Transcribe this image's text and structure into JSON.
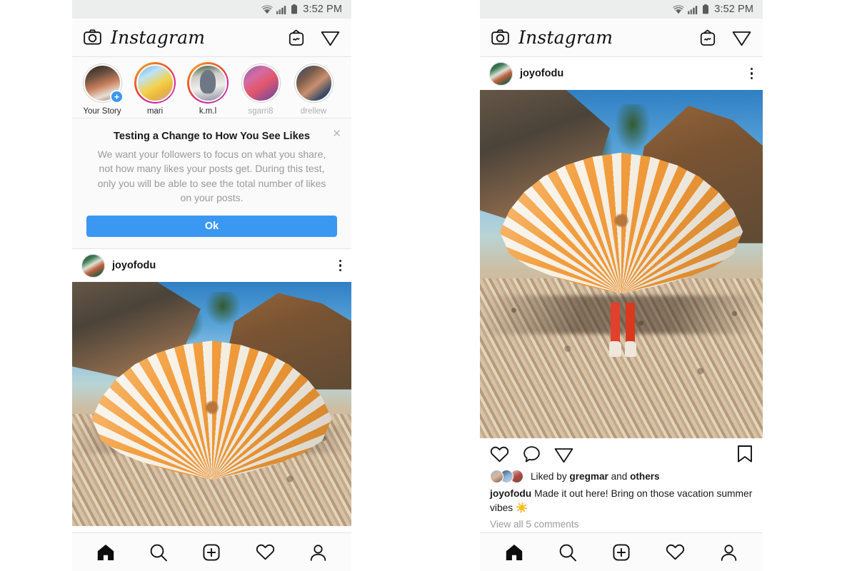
{
  "status_bar": {
    "time": "3:52 PM",
    "icons": [
      "wifi-icon",
      "cellular-signal-icon",
      "battery-icon"
    ]
  },
  "app_header": {
    "camera_icon": "camera-icon",
    "brand": "Instagram",
    "igtv_icon": "igtv-icon",
    "direct_message_icon": "direct-message-icon"
  },
  "stories": [
    {
      "name": "Your Story",
      "ring": "none",
      "muted": false,
      "has_add_badge": true,
      "thumb": "th1"
    },
    {
      "name": "mari",
      "ring": "gradient",
      "muted": false,
      "has_add_badge": false,
      "thumb": "th2"
    },
    {
      "name": "k.m.l",
      "ring": "gradient",
      "muted": false,
      "has_add_badge": false,
      "thumb": "th3"
    },
    {
      "name": "sgarri8",
      "ring": "plain",
      "muted": true,
      "has_add_badge": false,
      "thumb": "th4"
    },
    {
      "name": "drellew",
      "ring": "plain",
      "muted": true,
      "has_add_badge": false,
      "thumb": "th5"
    }
  ],
  "notice": {
    "title": "Testing a Change to How You See Likes",
    "body": "We want your followers to focus on what you share, not how many likes your posts get. During this test, only you will be able to see the total number of likes on your posts.",
    "ok_label": "Ok",
    "close_icon": "close-icon",
    "button_color": "#3b98f2"
  },
  "post": {
    "username": "joyofodu",
    "more_icon": "more-options-icon",
    "photo_alt": "person standing on pebble beach holding large orange and white striped umbrella",
    "like_icon": "heart-icon",
    "comment_icon": "comment-icon",
    "share_icon": "share-icon",
    "save_icon": "bookmark-icon",
    "liked_by_prefix": "Liked by ",
    "liked_by_name": "gregmar",
    "liked_by_middle": " and ",
    "liked_by_suffix": "others",
    "caption_user": "joyofodu",
    "caption_text": " Made it out here! Bring on those vacation summer vibes ☀️",
    "view_comments": "View all 5 comments"
  },
  "tab_bar": {
    "items": [
      {
        "name": "home-tab",
        "icon": "home-icon",
        "active": true
      },
      {
        "name": "search-tab",
        "icon": "search-icon",
        "active": false
      },
      {
        "name": "create-tab",
        "icon": "plus-square-icon",
        "active": false
      },
      {
        "name": "activity-tab",
        "icon": "heart-icon",
        "active": false
      },
      {
        "name": "profile-tab",
        "icon": "person-icon",
        "active": false
      }
    ]
  },
  "colors": {
    "instagram_blue": "#3b98f2",
    "status_bar_bg": "#eceded",
    "panel_bg": "#ffffff",
    "muted_text": "#9a9a9a",
    "umbrella_orange": "#ef9b3c",
    "umbrella_white": "#f7f1e6"
  }
}
